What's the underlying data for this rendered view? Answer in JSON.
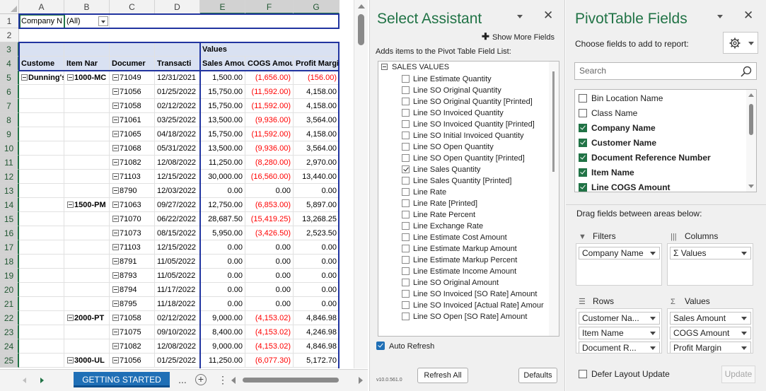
{
  "sheet": {
    "columns": [
      "A",
      "B",
      "C",
      "D",
      "E",
      "F",
      "G"
    ],
    "rows": [
      "1",
      "2",
      "3",
      "4",
      "5",
      "6",
      "7",
      "8",
      "9",
      "10",
      "11",
      "12",
      "13",
      "14",
      "15",
      "16",
      "17",
      "18",
      "19",
      "20",
      "21",
      "22",
      "23",
      "24",
      "25"
    ],
    "filter_label": "Company N",
    "filter_value": "(All)",
    "values_header": "Values",
    "headers": [
      "Custome",
      "Item Nar",
      "Documer",
      "Transacti",
      "Sales Amour",
      "COGS Amoun",
      "Profit Margin"
    ],
    "data": [
      {
        "cust": "Dunning's",
        "item": "1000-MC",
        "doc": "71049",
        "date": "12/31/2021",
        "sales": "1,500.00",
        "cogs": "(1,656.00)",
        "profit": "(156.00)",
        "profit_neg": true
      },
      {
        "cust": "",
        "item": "",
        "doc": "71056",
        "date": "01/25/2022",
        "sales": "15,750.00",
        "cogs": "(11,592.00)",
        "profit": "4,158.00"
      },
      {
        "cust": "",
        "item": "",
        "doc": "71058",
        "date": "02/12/2022",
        "sales": "15,750.00",
        "cogs": "(11,592.00)",
        "profit": "4,158.00"
      },
      {
        "cust": "",
        "item": "",
        "doc": "71061",
        "date": "03/25/2022",
        "sales": "13,500.00",
        "cogs": "(9,936.00)",
        "profit": "3,564.00"
      },
      {
        "cust": "",
        "item": "",
        "doc": "71065",
        "date": "04/18/2022",
        "sales": "15,750.00",
        "cogs": "(11,592.00)",
        "profit": "4,158.00"
      },
      {
        "cust": "",
        "item": "",
        "doc": "71068",
        "date": "05/31/2022",
        "sales": "13,500.00",
        "cogs": "(9,936.00)",
        "profit": "3,564.00"
      },
      {
        "cust": "",
        "item": "",
        "doc": "71082",
        "date": "12/08/2022",
        "sales": "11,250.00",
        "cogs": "(8,280.00)",
        "profit": "2,970.00"
      },
      {
        "cust": "",
        "item": "",
        "doc": "71103",
        "date": "12/15/2022",
        "sales": "30,000.00",
        "cogs": "(16,560.00)",
        "profit": "13,440.00"
      },
      {
        "cust": "",
        "item": "",
        "doc": "8790",
        "date": "12/03/2022",
        "sales": "0.00",
        "cogs": "0.00",
        "profit": "0.00",
        "cogs_pos": true
      },
      {
        "cust": "",
        "item": "1500-PM",
        "doc": "71063",
        "date": "09/27/2022",
        "sales": "12,750.00",
        "cogs": "(6,853.00)",
        "profit": "5,897.00"
      },
      {
        "cust": "",
        "item": "",
        "doc": "71070",
        "date": "06/22/2022",
        "sales": "28,687.50",
        "cogs": "(15,419.25)",
        "profit": "13,268.25"
      },
      {
        "cust": "",
        "item": "",
        "doc": "71073",
        "date": "08/15/2022",
        "sales": "5,950.00",
        "cogs": "(3,426.50)",
        "profit": "2,523.50"
      },
      {
        "cust": "",
        "item": "",
        "doc": "71103",
        "date": "12/15/2022",
        "sales": "0.00",
        "cogs": "0.00",
        "profit": "0.00",
        "cogs_pos": true
      },
      {
        "cust": "",
        "item": "",
        "doc": "8791",
        "date": "11/05/2022",
        "sales": "0.00",
        "cogs": "0.00",
        "profit": "0.00",
        "cogs_pos": true
      },
      {
        "cust": "",
        "item": "",
        "doc": "8793",
        "date": "11/05/2022",
        "sales": "0.00",
        "cogs": "0.00",
        "profit": "0.00",
        "cogs_pos": true
      },
      {
        "cust": "",
        "item": "",
        "doc": "8794",
        "date": "11/17/2022",
        "sales": "0.00",
        "cogs": "0.00",
        "profit": "0.00",
        "cogs_pos": true
      },
      {
        "cust": "",
        "item": "",
        "doc": "8795",
        "date": "11/18/2022",
        "sales": "0.00",
        "cogs": "0.00",
        "profit": "0.00",
        "cogs_pos": true
      },
      {
        "cust": "",
        "item": "2000-PT",
        "doc": "71058",
        "date": "02/12/2022",
        "sales": "9,000.00",
        "cogs": "(4,153.02)",
        "profit": "4,846.98"
      },
      {
        "cust": "",
        "item": "",
        "doc": "71075",
        "date": "09/10/2022",
        "sales": "8,400.00",
        "cogs": "(4,153.02)",
        "profit": "4,246.98"
      },
      {
        "cust": "",
        "item": "",
        "doc": "71082",
        "date": "12/08/2022",
        "sales": "9,000.00",
        "cogs": "(4,153.02)",
        "profit": "4,846.98"
      },
      {
        "cust": "",
        "item": "3000-UL",
        "doc": "71056",
        "date": "01/25/2022",
        "sales": "11,250.00",
        "cogs": "(6,077.30)",
        "profit": "5,172.70"
      }
    ],
    "active_tab": "GETTING STARTED",
    "more_tabs": "...",
    "add_sheet": "+",
    "tab_menu": "⋮"
  },
  "assistant": {
    "title": "Select Assistant",
    "show_more": "Show More Fields",
    "subtitle": "Adds items to the Pivot Table Field List:",
    "group": "SALES VALUES",
    "items": [
      {
        "label": "Line Estimate Quantity",
        "checked": false
      },
      {
        "label": "Line SO Original Quantity",
        "checked": false
      },
      {
        "label": "Line SO Original Quantity [Printed]",
        "checked": false
      },
      {
        "label": "Line SO Invoiced Quantity",
        "checked": false
      },
      {
        "label": "Line SO Invoiced Quantity [Printed]",
        "checked": false
      },
      {
        "label": "Line SO Initial Invoiced Quantity",
        "checked": false
      },
      {
        "label": "Line SO Open Quantity",
        "checked": false
      },
      {
        "label": "Line SO Open Quantity [Printed]",
        "checked": false
      },
      {
        "label": "Line Sales Quantity",
        "checked": true
      },
      {
        "label": "Line Sales Quantity [Printed]",
        "checked": false
      },
      {
        "label": "Line Rate",
        "checked": false
      },
      {
        "label": "Line Rate [Printed]",
        "checked": false
      },
      {
        "label": "Line Rate Percent",
        "checked": false
      },
      {
        "label": "Line Exchange Rate",
        "checked": false
      },
      {
        "label": "Line Estimate Cost Amount",
        "checked": false
      },
      {
        "label": "Line Estimate Markup Amount",
        "checked": false
      },
      {
        "label": "Line Estimate Markup Percent",
        "checked": false
      },
      {
        "label": "Line Estimate Income Amount",
        "checked": false
      },
      {
        "label": "Line SO Original Amount",
        "checked": false
      },
      {
        "label": "Line SO Invoiced [SO Rate] Amount",
        "checked": false
      },
      {
        "label": "Line SO Invoiced [Actual Rate] Amour",
        "checked": false
      },
      {
        "label": "Line SO Open [SO Rate] Amount",
        "checked": false
      }
    ],
    "auto_refresh": "Auto Refresh",
    "version": "v10.0.561.0",
    "refresh_all": "Refresh All",
    "defaults": "Defaults"
  },
  "pivot_fields": {
    "title": "PivotTable Fields",
    "subtitle": "Choose fields to add to report:",
    "search_placeholder": "Search",
    "fields": [
      {
        "label": "Bin Location Name",
        "checked": false
      },
      {
        "label": "Class Name",
        "checked": false
      },
      {
        "label": "Company Name",
        "checked": true
      },
      {
        "label": "Customer Name",
        "checked": true
      },
      {
        "label": "Document Reference Number",
        "checked": true
      },
      {
        "label": "Item Name",
        "checked": true
      },
      {
        "label": "Line COGS Amount",
        "checked": true
      }
    ],
    "drag_label": "Drag fields between areas below:",
    "filters_title": "Filters",
    "columns_title": "Columns",
    "rows_title": "Rows",
    "values_title": "Values",
    "filters": [
      "Company Name"
    ],
    "columns": [
      "Σ  Values"
    ],
    "rows": [
      "Customer Na...",
      "Item Name",
      "Document R..."
    ],
    "values": [
      "Sales Amount",
      "COGS Amount",
      "Profit Margin"
    ],
    "defer": "Defer Layout Update",
    "update": "Update"
  },
  "colors": {
    "excel_green": "#217346",
    "pivot_header_fill": "#d9e1f2",
    "negative": "#ff0000",
    "tab_blue": "#1f6fb6"
  }
}
